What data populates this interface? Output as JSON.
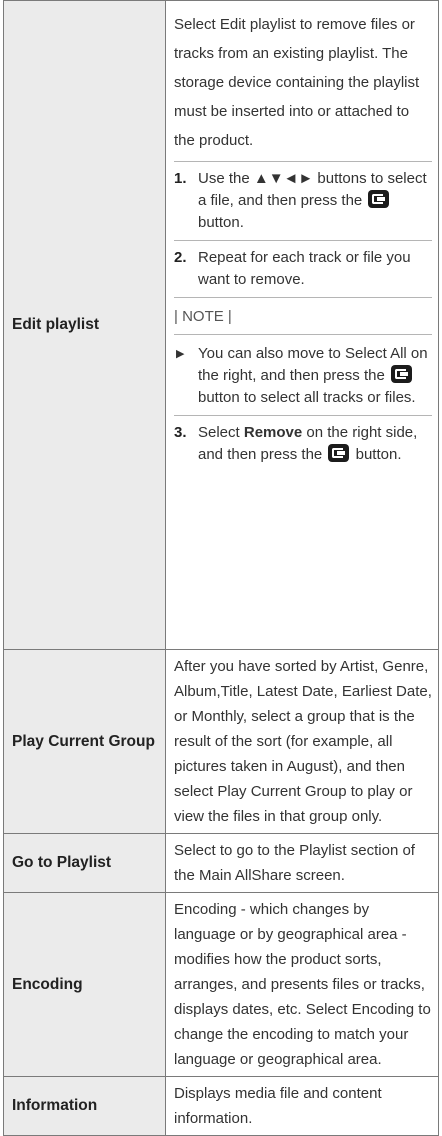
{
  "rows": {
    "edit_playlist": {
      "term": "Edit playlist",
      "intro": "Select Edit playlist to remove files or tracks from an existing playlist. The storage device containing the playlist must be inserted into or attached to the product.",
      "step1_num": "1.",
      "step1_text_a": "Use the ▲▼◄► buttons to select a file, and then press the",
      "step1_text_b": "button.",
      "step2_num": "2.",
      "step2_text": "Repeat for each track or file you want to remove.",
      "note_label": "| NOTE |",
      "bullet_text_a": "You can also move to Select All on the right, and then press the",
      "bullet_text_b": "button to select all tracks or files.",
      "step3_num": "3.",
      "step3_text_a": "Select",
      "step3_bold": "Remove",
      "step3_text_b": "on the right side, and then press the",
      "step3_text_c": "button."
    },
    "play_current_group": {
      "term": "Play Current Group",
      "desc": "After you have sorted by Artist, Genre, Album,Title, Latest Date, Earliest Date, or Monthly, select a group that is the result of the sort (for example, all pictures taken in August), and then select Play Current Group to play or view the files in that group only."
    },
    "go_to_playlist": {
      "term": "Go to Playlist",
      "desc": "Select to go to the Playlist section of the Main AllShare screen."
    },
    "encoding": {
      "term": "Encoding",
      "desc": "Encoding - which changes by language or by geographical area - modifies how the product sorts, arranges, and presents files or tracks, displays dates, etc. Select Encoding to change the encoding to match your language or geographical area."
    },
    "information": {
      "term": "Information",
      "desc": "Displays media file and content information."
    }
  },
  "icons": {
    "enter": "enter-button-icon",
    "bullet": "triangle-bullet-icon"
  }
}
